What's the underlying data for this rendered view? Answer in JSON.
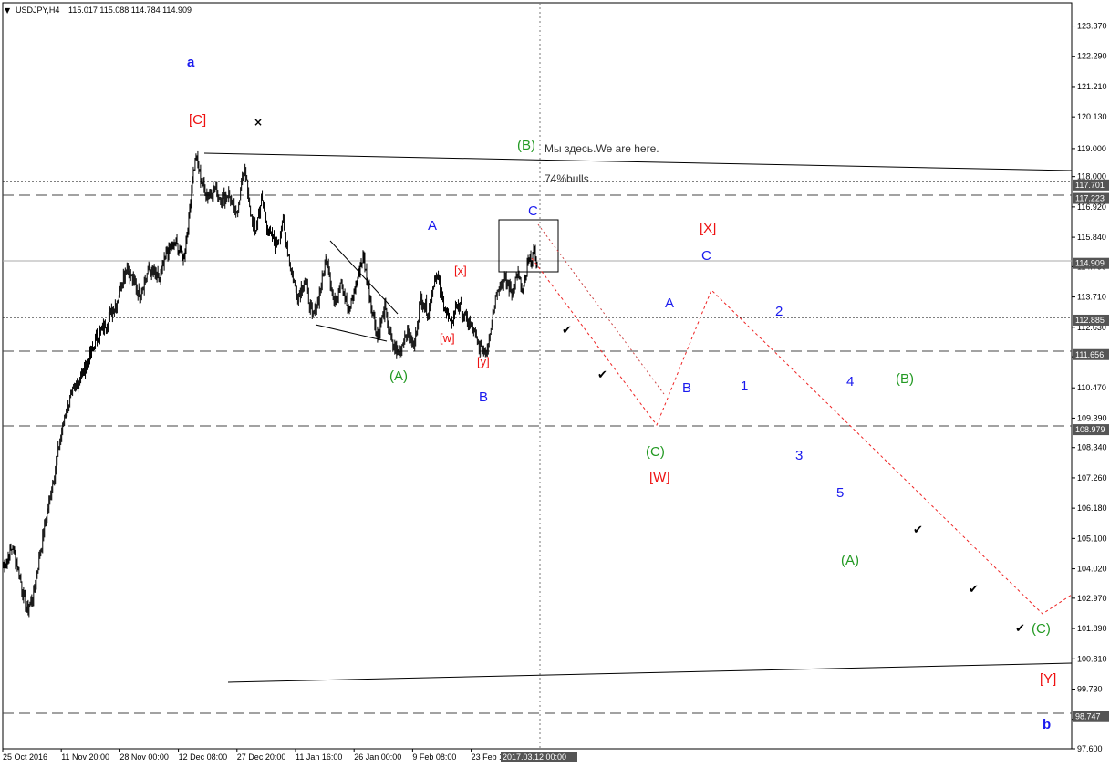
{
  "header": {
    "symbol": "USDJPY,H4",
    "ohlc": "115.017 115.088 114.784 114.909"
  },
  "colors": {
    "background": "#ffffff",
    "candles": "#000000",
    "forecast": "#ee2222",
    "wave_blue": "#1a1aee",
    "wave_red": "#ee1111",
    "wave_green": "#229922",
    "tag_bg": "#555555"
  },
  "annotations": {
    "we_are_here": "Мы здесь.We are here.",
    "bulls": "74%bulls"
  },
  "chart_data": {
    "type": "candlestick",
    "title": "",
    "xlabel": "",
    "ylabel": "",
    "symbol": "USDJPY",
    "timeframe": "H4",
    "grid": false,
    "ylim": [
      97.6,
      124.2
    ],
    "y_ticks": [
      "123.370",
      "122.290",
      "121.210",
      "120.130",
      "119.000",
      "118.000",
      "116.920",
      "115.840",
      "114.790",
      "113.710",
      "112.630",
      "111.580",
      "110.470",
      "109.390",
      "108.340",
      "107.260",
      "106.180",
      "105.100",
      "104.020",
      "102.970",
      "101.890",
      "100.810",
      "99.730",
      "98.650",
      "97.600"
    ],
    "x_ticks": [
      "25 Oct 2016",
      "11 Nov 20:00",
      "28 Nov 00:00",
      "12 Dec 08:00",
      "27 Dec 20:00",
      "11 Jan 16:00",
      "26 Jan 00:00",
      "9 Feb 08:00",
      "23 Feb 1"
    ],
    "current_time_label": "2017.03.12 00:00",
    "last_price": 114.909,
    "price_tags": [
      {
        "price": 117.701,
        "label": "117.701"
      },
      {
        "price": 117.223,
        "label": "117.223"
      },
      {
        "price": 114.909,
        "label": "114.909"
      },
      {
        "price": 112.885,
        "label": "112.885"
      },
      {
        "price": 111.656,
        "label": "111.656"
      },
      {
        "price": 108.979,
        "label": "108.979"
      },
      {
        "price": 98.747,
        "label": "98.747"
      }
    ],
    "price_series_anchors": [
      {
        "bar": 0,
        "price": 104.1
      },
      {
        "bar": 10,
        "price": 104.8
      },
      {
        "bar": 18,
        "price": 103.7
      },
      {
        "bar": 25,
        "price": 102.5
      },
      {
        "bar": 32,
        "price": 103.0
      },
      {
        "bar": 38,
        "price": 104.2
      },
      {
        "bar": 48,
        "price": 106.0
      },
      {
        "bar": 58,
        "price": 107.8
      },
      {
        "bar": 68,
        "price": 109.6
      },
      {
        "bar": 80,
        "price": 110.6
      },
      {
        "bar": 90,
        "price": 111.2
      },
      {
        "bar": 102,
        "price": 112.2
      },
      {
        "bar": 115,
        "price": 112.9
      },
      {
        "bar": 125,
        "price": 113.6
      },
      {
        "bar": 135,
        "price": 114.8
      },
      {
        "bar": 150,
        "price": 113.8
      },
      {
        "bar": 160,
        "price": 114.7
      },
      {
        "bar": 172,
        "price": 114.3
      },
      {
        "bar": 180,
        "price": 115.3
      },
      {
        "bar": 190,
        "price": 115.6
      },
      {
        "bar": 198,
        "price": 115.1
      },
      {
        "bar": 204,
        "price": 116.4
      },
      {
        "bar": 208,
        "price": 118.0
      },
      {
        "bar": 212,
        "price": 118.7
      },
      {
        "bar": 218,
        "price": 117.8
      },
      {
        "bar": 225,
        "price": 117.3
      },
      {
        "bar": 232,
        "price": 117.6
      },
      {
        "bar": 240,
        "price": 117.2
      },
      {
        "bar": 248,
        "price": 117.4
      },
      {
        "bar": 256,
        "price": 116.6
      },
      {
        "bar": 262,
        "price": 117.7
      },
      {
        "bar": 266,
        "price": 118.4
      },
      {
        "bar": 270,
        "price": 117.0
      },
      {
        "bar": 277,
        "price": 116.0
      },
      {
        "bar": 284,
        "price": 117.2
      },
      {
        "bar": 292,
        "price": 116.0
      },
      {
        "bar": 300,
        "price": 115.6
      },
      {
        "bar": 308,
        "price": 116.3
      },
      {
        "bar": 316,
        "price": 114.8
      },
      {
        "bar": 324,
        "price": 113.7
      },
      {
        "bar": 332,
        "price": 114.4
      },
      {
        "bar": 340,
        "price": 112.9
      },
      {
        "bar": 348,
        "price": 113.8
      },
      {
        "bar": 356,
        "price": 115.2
      },
      {
        "bar": 364,
        "price": 113.4
      },
      {
        "bar": 372,
        "price": 114.4
      },
      {
        "bar": 380,
        "price": 113.1
      },
      {
        "bar": 388,
        "price": 114.1
      },
      {
        "bar": 396,
        "price": 115.2
      },
      {
        "bar": 404,
        "price": 113.6
      },
      {
        "bar": 412,
        "price": 112.3
      },
      {
        "bar": 420,
        "price": 113.3
      },
      {
        "bar": 428,
        "price": 112.0
      },
      {
        "bar": 436,
        "price": 111.7
      },
      {
        "bar": 444,
        "price": 112.5
      },
      {
        "bar": 452,
        "price": 111.9
      },
      {
        "bar": 460,
        "price": 113.7
      },
      {
        "bar": 468,
        "price": 113.2
      },
      {
        "bar": 476,
        "price": 114.6
      },
      {
        "bar": 484,
        "price": 113.6
      },
      {
        "bar": 492,
        "price": 112.7
      },
      {
        "bar": 500,
        "price": 113.5
      },
      {
        "bar": 508,
        "price": 113.0
      },
      {
        "bar": 516,
        "price": 112.6
      },
      {
        "bar": 524,
        "price": 111.9
      },
      {
        "bar": 532,
        "price": 111.8
      },
      {
        "bar": 538,
        "price": 112.9
      },
      {
        "bar": 544,
        "price": 114.1
      },
      {
        "bar": 552,
        "price": 114.3
      },
      {
        "bar": 560,
        "price": 113.9
      },
      {
        "bar": 566,
        "price": 114.6
      },
      {
        "bar": 572,
        "price": 113.8
      },
      {
        "bar": 578,
        "price": 114.9
      },
      {
        "bar": 584,
        "price": 115.3
      },
      {
        "bar": 588,
        "price": 114.909
      }
    ]
  },
  "wave_labels": {
    "a": "a",
    "C_top": "[C]",
    "B_green": "(B)",
    "A1": "A",
    "x1": "[x]",
    "C1": "C",
    "w1": "[w]",
    "y1": "[y]",
    "A_green1": "(A)",
    "B1": "B",
    "X_red": "[X]",
    "C2": "C",
    "A2": "A",
    "B2": "B",
    "C_green1": "(C)",
    "W_red": "[W]",
    "n1": "1",
    "n2": "2",
    "n3": "3",
    "n4": "4",
    "n5": "5",
    "B_green2": "(B)",
    "A_green2": "(A)",
    "C_green2": "(C)",
    "Y_red": "[Y]",
    "b": "b"
  },
  "icons": {
    "check": "check-icon",
    "cross": "cross-icon"
  }
}
